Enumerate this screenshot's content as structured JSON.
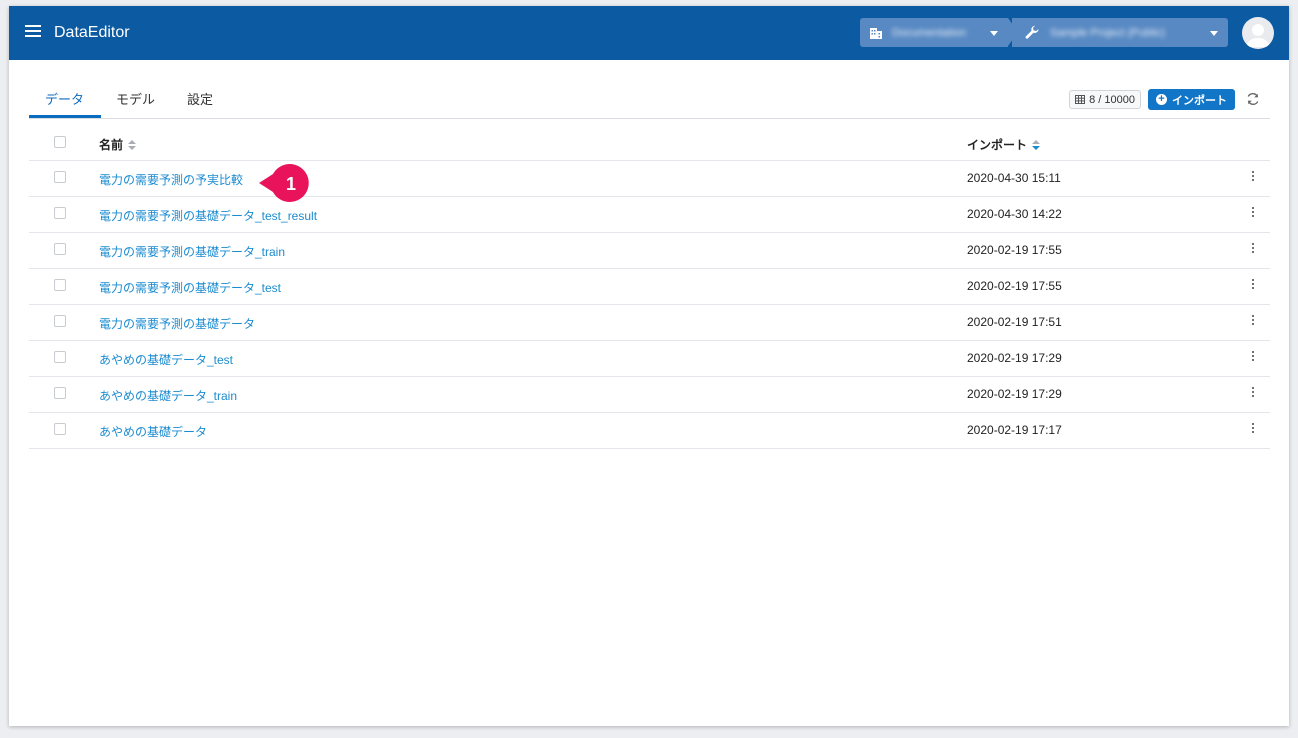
{
  "header": {
    "app_title": "DataEditor",
    "org_label": "Documentation",
    "project_label": "Sample Project (Public)"
  },
  "tabs": [
    {
      "label": "データ"
    },
    {
      "label": "モデル"
    },
    {
      "label": "設定"
    }
  ],
  "toolbar": {
    "quota": "8 / 10000",
    "import_label": "インポート"
  },
  "table": {
    "col_name": "名前",
    "col_import": "インポート",
    "rows": [
      {
        "name": "電力の需要予測の予実比較",
        "date": "2020-04-30 15:11"
      },
      {
        "name": "電力の需要予測の基礎データ_test_result",
        "date": "2020-04-30 14:22"
      },
      {
        "name": "電力の需要予測の基礎データ_train",
        "date": "2020-02-19 17:55"
      },
      {
        "name": "電力の需要予測の基礎データ_test",
        "date": "2020-02-19 17:55"
      },
      {
        "name": "電力の需要予測の基礎データ",
        "date": "2020-02-19 17:51"
      },
      {
        "name": "あやめの基礎データ_test",
        "date": "2020-02-19 17:29"
      },
      {
        "name": "あやめの基礎データ_train",
        "date": "2020-02-19 17:29"
      },
      {
        "name": "あやめの基礎データ",
        "date": "2020-02-19 17:17"
      }
    ]
  },
  "callout": {
    "number": "1",
    "color": "#e8135a"
  },
  "colors": {
    "header": "#0b5aa2",
    "accent": "#0b6bbf",
    "link": "#1b8bd0"
  }
}
